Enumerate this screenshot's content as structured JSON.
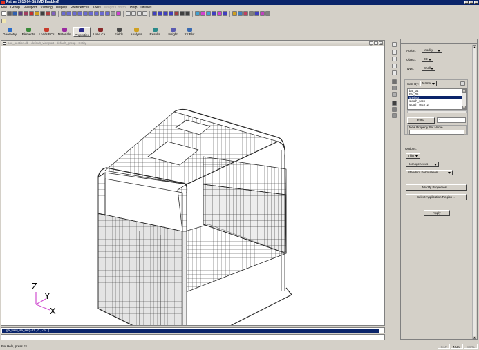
{
  "window": {
    "title": "Patran 2010 64-Bit (MD Enabled)",
    "min": "_",
    "max": "□",
    "close": "×"
  },
  "menu": [
    "File",
    "Group",
    "Viewport",
    "Viewing",
    "Display",
    "Preferences",
    "Tools",
    "Insight Control",
    "Help",
    "Utilities"
  ],
  "menu_disabled_index": 7,
  "apps": [
    {
      "label": "Geometry",
      "color": "#2a6cc8"
    },
    {
      "label": "Elements",
      "color": "#3a8a3a"
    },
    {
      "label": "Loads/BCs",
      "color": "#c83a2a"
    },
    {
      "label": "Materials",
      "color": "#9a2aa0"
    },
    {
      "label": "Properties",
      "color": "#2a2a8a"
    },
    {
      "label": "Load Ca...",
      "color": "#8a2a2a"
    },
    {
      "label": "Fields",
      "color": "#4a4a4a"
    },
    {
      "label": "Analysis",
      "color": "#d0a020"
    },
    {
      "label": "Results",
      "color": "#2a8a8a"
    },
    {
      "label": "Insight",
      "color": "#5a5ab0"
    },
    {
      "label": "XY Plot",
      "color": "#3a6ab0"
    }
  ],
  "active_app_index": 4,
  "viewport": {
    "title": "box_section.db - default_viewport - default_group - Entity",
    "btn_min": "_",
    "btn_max": "□",
    "btn_close": "×",
    "triad": {
      "z": "Z",
      "y": "Y",
      "x": "X"
    }
  },
  "command": {
    "history": "ga_view_aa_set( -67., 0., -34. )",
    "input": ""
  },
  "status": {
    "help": "For Help, press F1",
    "cells": [
      {
        "label": "CAP",
        "on": false
      },
      {
        "label": "NUM",
        "on": true
      },
      {
        "label": "SCRL",
        "on": false
      }
    ]
  },
  "panel": {
    "action_label": "Action:",
    "action_value": "Modify",
    "object_label": "Object:",
    "object_value": "2D",
    "type_label": "Type:",
    "type_value": "Shell",
    "sets_by_label": "Sets By:",
    "sets_by_value": "Name",
    "property_sets": [
      "bar_04",
      "bar_05",
      "shellvtx",
      "stooth_sech",
      "stooth_sech_2"
    ],
    "selected_set_index": 2,
    "filter_button": "Filter",
    "filter_value": "*",
    "new_set_label": "New Property Set Name",
    "new_set_value": "",
    "options_label": "Options:",
    "opt_thickness": "Thin",
    "opt_homog": "Homogeneous",
    "opt_formulation": "Standard Formulation",
    "modify_button": "Modify Properties ...",
    "region_button": "Select Application Region ...",
    "apply_button": "Apply"
  },
  "colors": {
    "titlebar": "#0a246a",
    "selection": "#0a246a",
    "chrome": "#d4d0c8",
    "mesh_line": "#2a2a2a",
    "mesh_fill": "#f4f4f4",
    "panel_fill": "#dcdcdc",
    "triad_line": "#d050d0"
  }
}
